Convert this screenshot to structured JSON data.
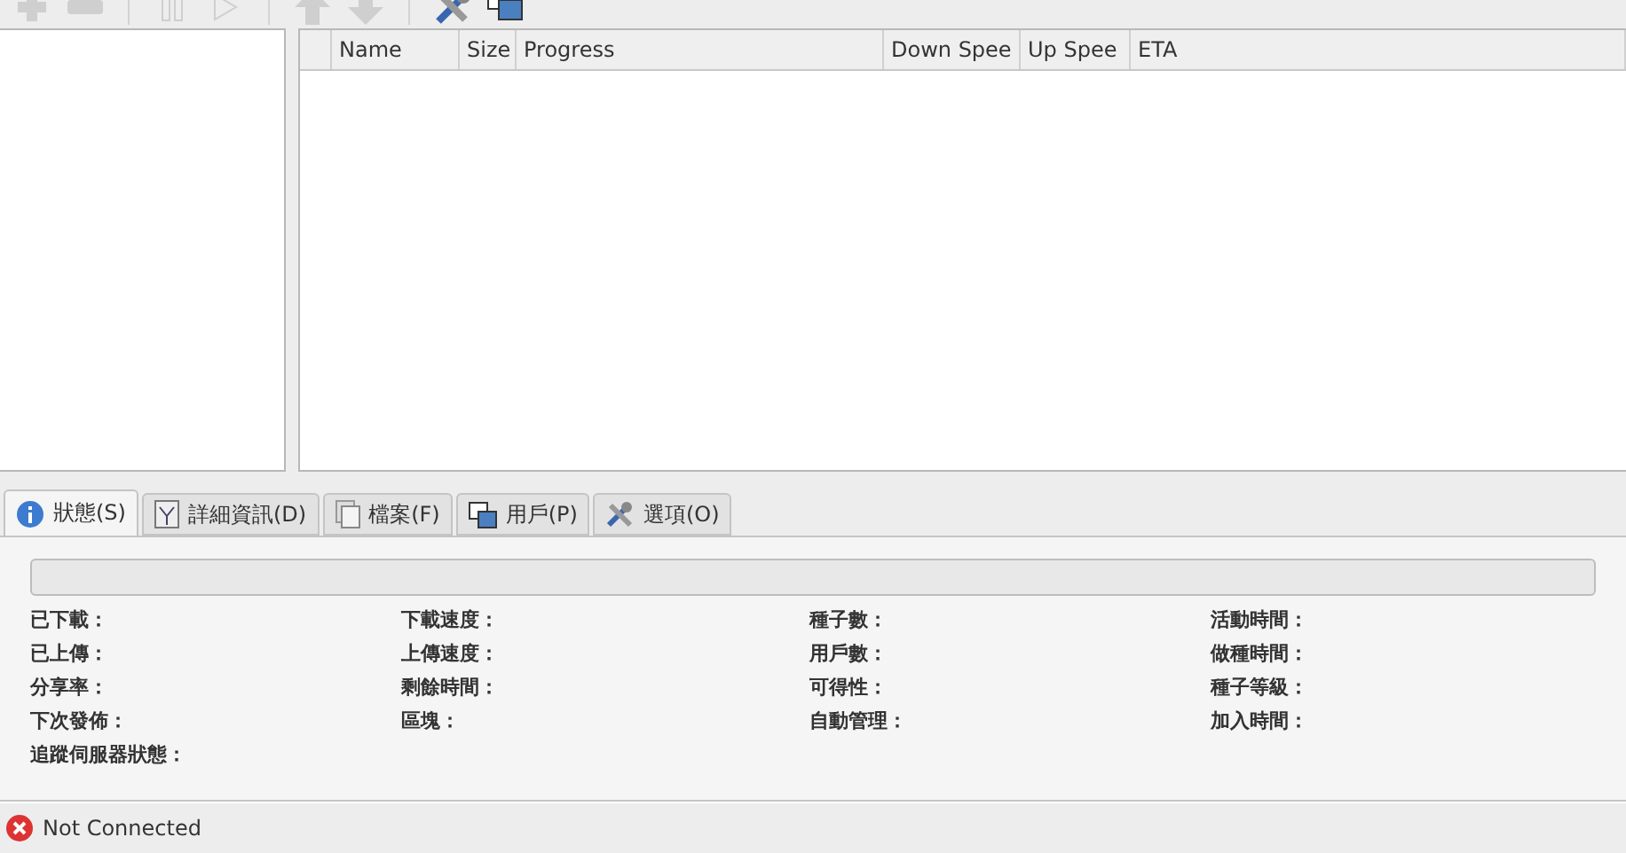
{
  "toolbar": [
    {
      "kind": "add",
      "disabled": true
    },
    {
      "kind": "remove",
      "disabled": true
    },
    {
      "kind": "sep"
    },
    {
      "kind": "pause",
      "disabled": true
    },
    {
      "kind": "resume",
      "disabled": true
    },
    {
      "kind": "sep"
    },
    {
      "kind": "up",
      "disabled": true
    },
    {
      "kind": "down",
      "disabled": true
    },
    {
      "kind": "sep"
    },
    {
      "kind": "prefs",
      "disabled": false
    },
    {
      "kind": "connections",
      "disabled": false
    }
  ],
  "table": {
    "columns": [
      "Name",
      "Size",
      "Progress",
      "Down Spee",
      "Up Spee",
      "ETA"
    ]
  },
  "tabs": [
    {
      "label": "狀態(S)",
      "kind": "info",
      "selected": true
    },
    {
      "label": "詳細資訊(D)",
      "kind": "details",
      "selected": false
    },
    {
      "label": "檔案(F)",
      "kind": "files",
      "selected": false
    },
    {
      "label": "用戶(P)",
      "kind": "peers",
      "selected": false
    },
    {
      "label": "選項(O)",
      "kind": "prefs",
      "selected": false
    }
  ],
  "status_panel": {
    "progress": {
      "level": 0
    },
    "fields": [
      [
        "已下載：",
        "已上傳：",
        "分享率：",
        "下次發佈：",
        "追蹤伺服器狀態："
      ],
      [
        "下載速度：",
        "上傳速度：",
        "剩餘時間：",
        "區塊："
      ],
      [
        "種子數：",
        "用戶數：",
        "可得性：",
        "自動管理："
      ],
      [
        "活動時間：",
        "做種時間：",
        "種子等級：",
        "加入時間："
      ]
    ]
  },
  "status_bar": {
    "connected": false,
    "text": "Not Connected"
  }
}
